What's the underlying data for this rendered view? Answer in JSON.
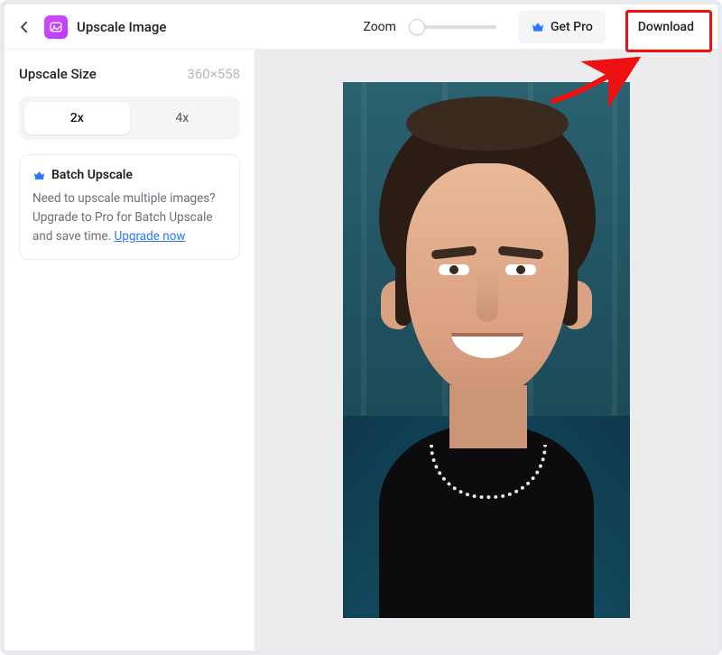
{
  "header": {
    "title": "Upscale Image",
    "zoom_label": "Zoom",
    "getpro_label": "Get Pro",
    "download_label": "Download"
  },
  "sidebar": {
    "size_label": "Upscale Size",
    "size_value": "360×558",
    "seg": {
      "opt_2x": "2x",
      "opt_4x": "4x",
      "active": "2x"
    },
    "batch_card": {
      "title": "Batch Upscale",
      "desc": "Need to upscale multiple images? Upgrade to Pro for Batch Upscale and save time. ",
      "link_label": "Upgrade now"
    }
  },
  "colors": {
    "accent": "#2876ff",
    "highlight": "#e11"
  }
}
